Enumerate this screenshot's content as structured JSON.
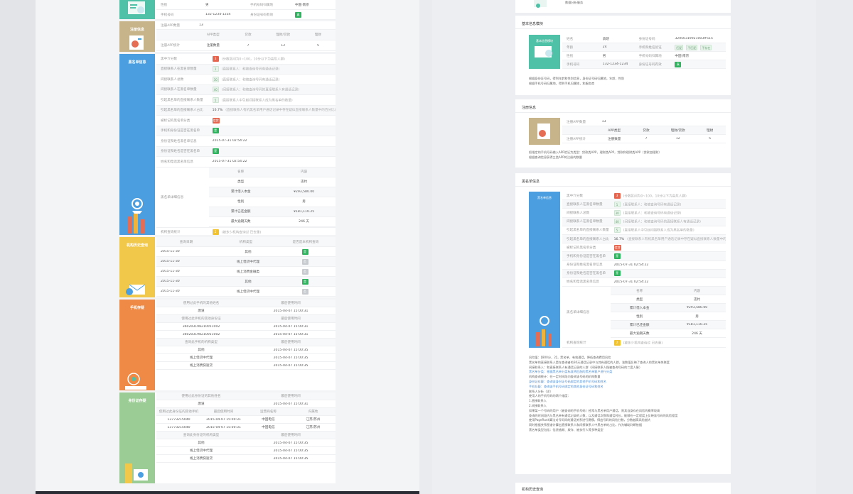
{
  "left": {
    "basic": {
      "rows": [
        [
          "性别",
          "男",
          "手机号码归属地",
          "中国·南京"
        ],
        [
          "手机号码",
          "132-1234-1234",
          "身份证号码有效",
          "真"
        ]
      ]
    },
    "register": {
      "title": "注册信息",
      "rows": [
        [
          "注册APP数量",
          "13"
        ],
        [
          "",
          "APP类型",
          "贷款",
          "理财/贷款",
          "理财"
        ],
        [
          "注册APP统计",
          "注册数量",
          "7",
          "12",
          "5"
        ]
      ]
    },
    "blacklist": {
      "title": "黑名单信息",
      "rows": [
        {
          "label": "黑中介分数",
          "badge": "3",
          "bc": "b-red",
          "note": "(分数区间为0~100，10分以下为高危人群)"
        },
        {
          "label": "直接联系人在黑名单数量",
          "badge": "1",
          "bc": "b-pale",
          "note": "(直接联系人：和被查询号码有通话记录)"
        },
        {
          "label": "间接联系人总数",
          "badge": "30",
          "bc": "b-pale",
          "note": "(直接联系人：和被查询号码有通话记录)"
        },
        {
          "label": "间接联系人在黑名单数量",
          "badge": "40",
          "bc": "b-pale",
          "note": "(间接联系人：和被查询号码的直接联系人有通话记录)"
        },
        {
          "label": "引起黑名单的直接联系人数量",
          "badge": "5",
          "bc": "b-pale",
          "note": "(直接联系人中引起间接联系人成为黑名单的数量)"
        },
        {
          "label": "引起黑名单的直接联系人占比",
          "badge": "",
          "bc": "",
          "value": "16.7%",
          "note": "(直接联系人有机黑名单用户通话记录中存在疑似直接联系人数量中的百分比)"
        },
        {
          "label": "被标记的黑名单分类",
          "badge": "信贷",
          "bc": "b-red",
          "note": ""
        },
        {
          "label": "手机和身份证是否在黑名单",
          "badge": "是",
          "bc": "b-green",
          "note": ""
        },
        {
          "label": "身份证和姓名黑名单信息",
          "badge": "",
          "bc": "",
          "value": "2015-07-31 02:54:22",
          "note": ""
        },
        {
          "label": "身份证和姓名是否在黑名单",
          "badge": "是",
          "bc": "b-green",
          "note": ""
        },
        {
          "label": "姓名和电话黑名单信息",
          "badge": "",
          "bc": "",
          "value": "2015-07-31 02:54:22",
          "note": ""
        }
      ],
      "detail": {
        "label": "黑名单详细信息",
        "head": [
          "名称",
          "内容"
        ],
        "rows": [
          [
            "类型",
            "违约"
          ],
          [
            "累计借入本金",
            "¥293,580.00"
          ],
          [
            "性别",
            "男"
          ],
          [
            "累计已还金额",
            "¥181,110.25"
          ],
          [
            "最大逾期天数",
            "246 天"
          ]
        ]
      },
      "footer": {
        "label": "机构查询统计",
        "badge": "2",
        "note": "(被多少机构查询过 已去重)"
      }
    },
    "history": {
      "title": "机构历史查询",
      "head": [
        "查询日期",
        "机构类型",
        "是否是本机构查询"
      ],
      "rows": [
        [
          "2015-11-30",
          "其他",
          "是",
          "b-green"
        ],
        [
          "2015-11-30",
          "线上借贷中代理",
          "否",
          "b-grey"
        ],
        [
          "2015-11-30",
          "线上消费金融类",
          "否",
          "b-grey"
        ],
        [
          "2015-11-30",
          "其他",
          "是",
          "b-green"
        ],
        [
          "2015-11-30",
          "线上借贷中代理",
          "否",
          "b-grey"
        ]
      ]
    },
    "phone": {
      "title": "手机存疑",
      "h1": [
        "使用过此手机的其他姓名",
        "最后使用时间"
      ],
      "r1": [
        [
          "唐道",
          "2015-04-07 15:00:31"
        ]
      ],
      "h2": [
        "使用过此手机的其他身份证",
        "最后使用时间"
      ],
      "r2": [
        [
          "360203198210051002",
          "2015-04-07 15:00:31"
        ],
        [
          "360203198210051002",
          "2015-04-07 15:00:31"
        ]
      ],
      "h3": [
        "查询此手机的机构类型",
        "最后使用时间"
      ],
      "r3": [
        [
          "其他",
          "2015-04-07 15:00:35"
        ],
        [
          "线上借贷中代理",
          "2015-04-07 15:00:35"
        ],
        [
          "线上消费快速贷",
          "2015-04-07 15:00:35"
        ]
      ]
    },
    "idcard": {
      "title": "身份证存疑",
      "h1": [
        "使用过此身份证的其他姓名",
        "最后使用时间"
      ],
      "r1": [
        [
          "唐道",
          "2015-04-07 15:00:31"
        ]
      ],
      "h2": [
        "使用过此身份证的其他手机",
        "最后使用时间",
        "运营商名称",
        "归属地"
      ],
      "r2": [
        [
          "13773215040",
          "2015-04-07 15:00:31",
          "中国电信",
          "江苏/苏州"
        ],
        [
          "13773215040",
          "2015-04-07 15:00:31",
          "中国电信",
          "江苏/苏州"
        ]
      ],
      "h3": [
        "查询此身份证的机构类型",
        "最后使用时间"
      ],
      "r3": [
        [
          "其他",
          "2015-04-07 15:00:35"
        ],
        [
          "线上借贷中代理",
          "2015-04-07 15:00:35"
        ],
        [
          "线上消费快速贷",
          "2015-04-07 15:00:35"
        ]
      ]
    }
  },
  "right": {
    "top_note": "数据分析服务",
    "basic": {
      "title": "基本信息模块",
      "rows": [
        [
          "姓名",
          "袁晓",
          "身份证号码",
          "32050319921003#515"
        ],
        [
          "年龄",
          "24",
          "手机和姓名验证",
          "匹配",
          "不匹配",
          "不存在"
        ],
        [
          "性别",
          "男",
          "手机号码归属地",
          "中国·南京"
        ],
        [
          "手机号码",
          "132-1234-1234",
          "身份证号码有效",
          "真"
        ]
      ],
      "note1": "根据身份证号码，得到年龄和性别信息，身份证号码归属地，年龄，性别",
      "note2": "根据手机号码归属地，得到手机归属地，和服务商"
    },
    "register": {
      "title": "注册信息",
      "rows": [
        [
          "注册APP数量",
          "13"
        ],
        [
          "",
          "APP类型",
          "贷款",
          "理财/贷款",
          "理财"
        ],
        [
          "注册APP统计",
          "注册数量",
          "7",
          "12",
          "5"
        ]
      ],
      "note1": "把指定的手机号码输入APP验证为类型：贷款类APP，理财类APP，贷款和理财类APP（贷款加理财）",
      "note2": "根据查询信息获得三类APP的注册的数量"
    },
    "blacklist_title": "黑名单信息",
    "blk_note": [
      "风险值：【800分，2】，黑名单，有效通话，降低查询费用风险",
      "黑名单的直接联系人是在查询者的30天通话记录中与其有通话的人群，该数值反映了查询人的黑名单关联度",
      "间接联系人：和直接联系人有通话记录的人群（间接联系人指被查询号码的二度人脉）",
      "黑名单分类：根据黑名单分类标准将匹配的黑名单客户进行分类",
      "机构查询统计：在一定时间段内查询该号码的机构数量",
      "身份证存疑：查询该身份证号码绑定的其他手机号码和姓名",
      "手机存疑：查询该手机号码绑定的其他身份证号码和姓名",
      "联系人分析（详）",
      "使用人的手机号码的两个维度：",
      "1.直接联系人",
      "2.间接联系人",
      "如果某一个号码的用户（被查询的手机号码）经常与黑名单用户通话，则其自身存在风险的概率较高",
      "查询的时间段内与黑名单有通话记录的人数，以及通话次数和通话时长，能够在一定程度上反映该号码的风险程度",
      "使用PageRank算法对号码间的通话关系进行建模，得出号码的风险分数，分数越高风险越大",
      "同时根据关系图谱计算出直接联系人和间接联系人中黑名单的占比，作为辅助判断依据",
      "黑名单类型包括：信贷逾期、欺诈、被执行人等多种类型"
    ],
    "history_title": "机构历史查询"
  }
}
